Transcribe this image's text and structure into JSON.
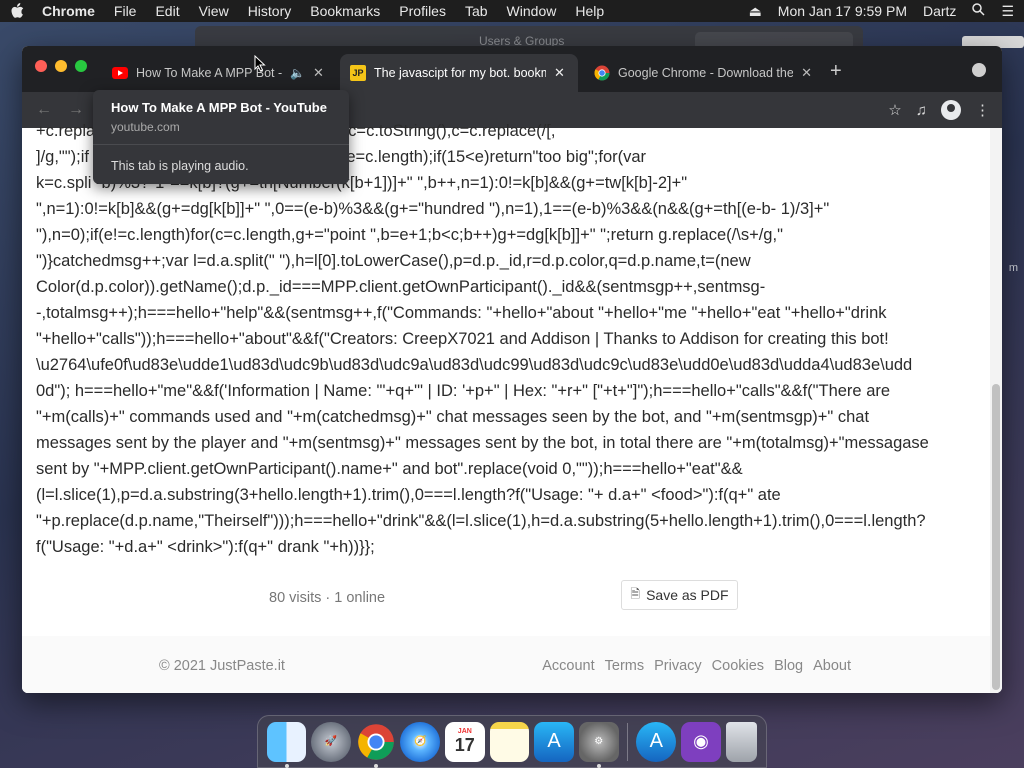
{
  "menubar": {
    "app": "Chrome",
    "items": [
      "File",
      "Edit",
      "View",
      "History",
      "Bookmarks",
      "Profiles",
      "Tab",
      "Window",
      "Help"
    ],
    "datetime": "Mon Jan 17  9:59 PM",
    "user": "Dartz"
  },
  "background_window": {
    "title": "Users & Groups"
  },
  "tabs": [
    {
      "label": "How To Make A MPP Bot - YouTube",
      "favicon": "youtube-icon",
      "audio": true
    },
    {
      "label": "The javascipt for my bot. bookmarklet",
      "favicon": "justpaste-icon",
      "favicon_text": "JP"
    },
    {
      "label": "Google Chrome - Download the Fast, Secure Browser",
      "favicon": "chrome-icon"
    }
  ],
  "tooltip": {
    "title": "How To Make A MPP Bot - YouTube",
    "url": "youtube.com",
    "audio_note": "This tab is playing audio."
  },
  "code_lines": [
    "+c.repla                    msgp+\",sentmsg++}function m(c){c=c.toString(),c=c.replace(/[,",
    "]/g,\"\");if                   ber\";var e=c.indexOf(\".\");-1==e&&(e=c.length);if(15<e)return\"too big\";for(var",
    "k=c.spli                  -b)%3?\"1\"==k[b]?(g+=tn[Number(k[b+1])]+\" \",b++,n=1):0!=k[b]&&(g+=tw[k[b]-2]+\"",
    "\",n=1):0!=k[b]&&(g+=dg[k[b]]+\" \",0==(e-b)%3&&(g+=\"hundred \"),n=1),1==(e-b)%3&&(n&&(g+=th[(e-b- 1)/3]+\"",
    "\"),n=0);if(e!=c.length)for(c=c.length,g+=\"point \",b=e+1;b<c;b++)g+=dg[k[b]]+\" \";return g.replace(/\\s+/g,\"",
    "\")}catchedmsg++;var l=d.a.split(\" \"),h=l[0].toLowerCase(),p=d.p._id,r=d.p.color,q=d.p.name,t=(new",
    "Color(d.p.color)).getName();d.p._id===MPP.client.getOwnParticipant()._id&&(sentmsgp++,sentmsg-",
    "-,totalmsg++);h===hello+\"help\"&&(sentmsg++,f(\"Commands: \"+hello+\"about \"+hello+\"me \"+hello+\"eat \"+hello+\"drink",
    "\"+hello+\"calls\"));h===hello+\"about\"&&f(\"Creators: CreepX7021 and Addison | Thanks to Addison for creating this bot!",
    "\\u2764\\ufe0f\\ud83e\\udde1\\ud83d\\udc9b\\ud83d\\udc9a\\ud83d\\udc99\\ud83d\\udc9c\\ud83e\\udd0e\\ud83d\\udda4\\ud83e\\udd",
    "0d\"); h===hello+\"me\"&&f('Information | Name: \"'+q+'\" | ID: '+p+\" | Hex: \"+r+\" [\"+t+\"]\");h===hello+\"calls\"&&f(\"There are",
    "\"+m(calls)+\" commands used and \"+m(catchedmsg)+\" chat messages seen by the bot, and \"+m(sentmsgp)+\" chat",
    "messages sent by the player and \"+m(sentmsg)+\" messages sent by the bot, in total there are \"+m(totalmsg)+\"messagase",
    "sent by \"+MPP.client.getOwnParticipant().name+\" and bot\".replace(void 0,\"\"));h===hello+\"eat\"&&",
    "(l=l.slice(1),p=d.a.substring(3+hello.length+1).trim(),0===l.length?f(\"Usage: \"+ d.a+\" <food>\"):f(q+\" ate",
    "\"+p.replace(d.p.name,\"Theirself\")));h===hello+\"drink\"&&(l=l.slice(1),h=d.a.substring(5+hello.length+1).trim(),0===l.length?",
    "f(\"Usage: \"+d.a+\" <drink>\"):f(q+\" drank \"+h))}};"
  ],
  "page": {
    "stats": "80 visits · 1 online",
    "save_pdf": "Save as PDF",
    "copyright": "© 2021 JustPaste.it",
    "footer_links": [
      "Account",
      "Terms",
      "Privacy",
      "Cookies",
      "Blog",
      "About"
    ]
  },
  "dock": {
    "apps": [
      {
        "name": "finder-icon",
        "color": "#2a8cf0"
      },
      {
        "name": "launchpad-icon",
        "color": "#8a8f99"
      },
      {
        "name": "chrome-icon",
        "color": "#ffffff"
      },
      {
        "name": "safari-icon",
        "color": "#1e88e5"
      },
      {
        "name": "calendar-icon",
        "color": "#ffffff",
        "text": "17"
      },
      {
        "name": "notes-icon",
        "color": "#f7e27a"
      },
      {
        "name": "app-store-icon",
        "color": "#1b8df2"
      },
      {
        "name": "system-preferences-icon",
        "color": "#7d7d7d"
      }
    ],
    "extras": [
      {
        "name": "app-store-folder-icon",
        "color": "#1b8df2"
      },
      {
        "name": "github-desktop-icon",
        "color": "#8e44ad"
      },
      {
        "name": "trash-icon",
        "color": "#b8bcc2"
      }
    ]
  }
}
